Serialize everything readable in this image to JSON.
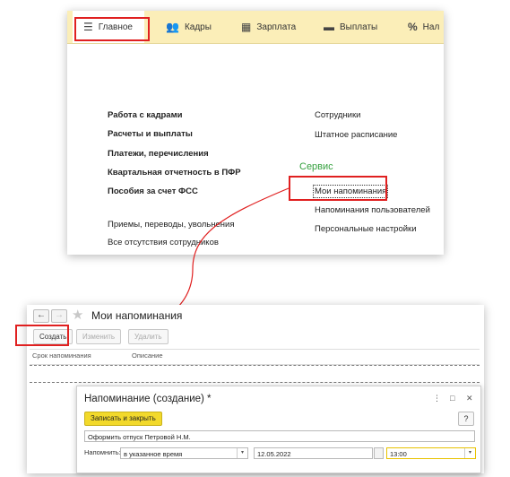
{
  "menu": {
    "items": [
      {
        "label": "Главное",
        "icon": "hamburger-icon"
      },
      {
        "label": "Кадры",
        "icon": "users-icon"
      },
      {
        "label": "Зарплата",
        "icon": "calculator-icon"
      },
      {
        "label": "Выплаты",
        "icon": "wallet-icon"
      },
      {
        "label": "Нал",
        "icon": "percent-icon"
      }
    ]
  },
  "sections": {
    "left_bold": [
      "Работа с кадрами",
      "Расчеты и выплаты",
      "Платежи, перечисления",
      "Квартальная отчетность в ПФР",
      "Пособия за счет ФСС"
    ],
    "left_regular": [
      "Приемы, переводы, увольнения",
      "Все отсутствия сотрудников"
    ],
    "right": [
      "Сотрудники",
      "Штатное расписание"
    ],
    "service_header": "Сервис",
    "service_items": [
      "Мои напоминания",
      "Напоминания пользователей",
      "Персональные настройки"
    ]
  },
  "reminders_window": {
    "title": "Мои напоминания",
    "toolbar": {
      "create": "Создать",
      "edit": "Изменить",
      "delete": "Удалить"
    },
    "columns": [
      "Срок напоминания",
      "Описание"
    ]
  },
  "dialog": {
    "title": "Напоминание (создание) *",
    "save_close": "Записать и закрыть",
    "help": "?",
    "description_value": "Оформить отпуск Петровой Н.М.",
    "remind_label": "Напомнить:",
    "remind_mode": "в указанное время",
    "date_value": "12.05.2022",
    "time_value": "13:00"
  },
  "colors": {
    "accent_red": "#e02020",
    "menu_bg": "#fbeeb8",
    "service_green": "#34a03e",
    "button_yellow": "#f2d92b"
  }
}
